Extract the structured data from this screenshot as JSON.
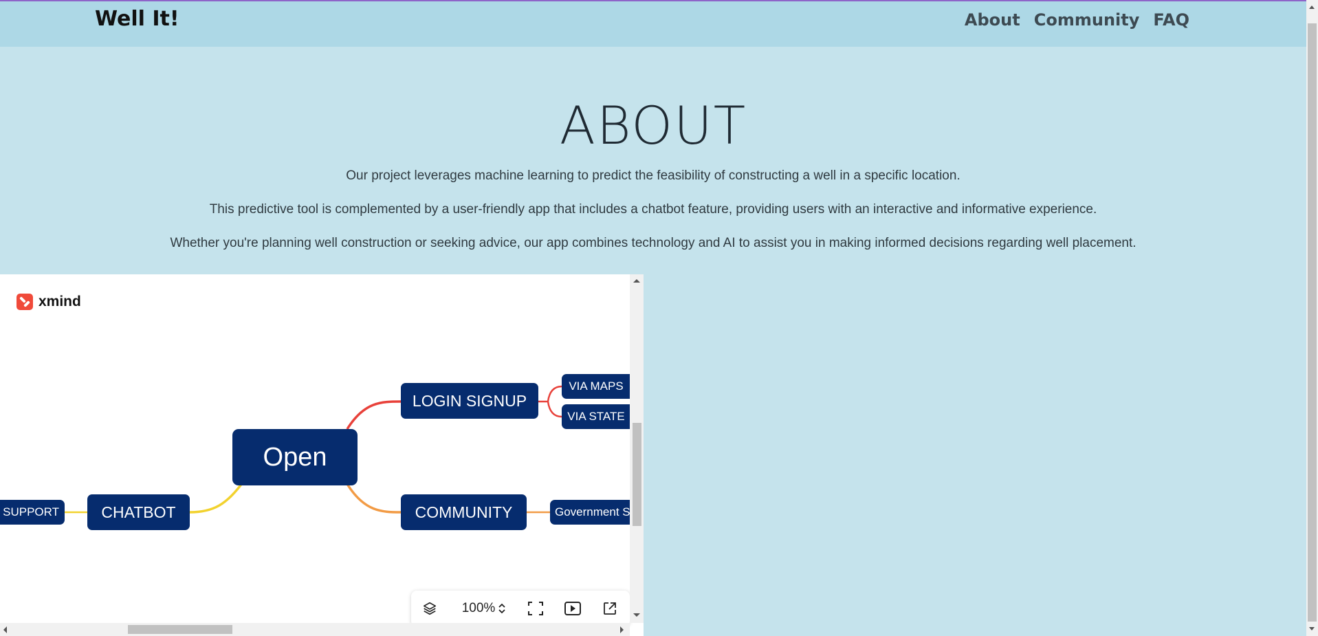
{
  "header": {
    "brand": "Well It!",
    "nav": [
      "About",
      "Community",
      "FAQ"
    ]
  },
  "about": {
    "title": "ABOUT",
    "paragraphs": [
      "Our project leverages machine learning to predict the feasibility of constructing a well in a specific location.",
      "This predictive tool is complemented by a user-friendly app that includes a chatbot feature, providing users with an interactive and informative experience.",
      "Whether you're planning well construction or seeking advice, our app combines technology and AI to assist you in making informed decisions regarding well placement."
    ]
  },
  "mindmap": {
    "logo_text": "xmind",
    "nodes": {
      "root": "Open",
      "login": "LOGIN SIGNUP",
      "via_maps": "VIA MAPS",
      "via_state": "VIA STATE",
      "community": "COMMUNITY",
      "government": "Government S",
      "chatbot": "CHATBOT",
      "support": "T SUPPORT"
    },
    "toolbar": {
      "zoom": "100%"
    },
    "colors": {
      "node": "#062c6e",
      "link_login": "#e8413a",
      "link_community": "#f29b45",
      "link_chatbot": "#f2d22e"
    }
  }
}
